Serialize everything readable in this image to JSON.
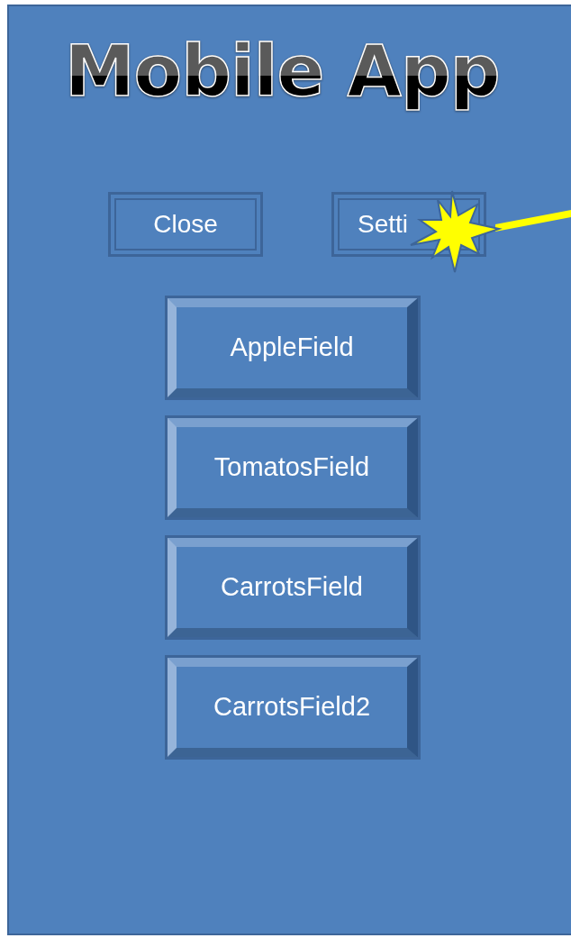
{
  "title": "Mobile App",
  "top_buttons": [
    {
      "label": "Close"
    },
    {
      "label": "Setti"
    }
  ],
  "field_buttons": [
    {
      "label": "AppleField"
    },
    {
      "label": "TomatosField"
    },
    {
      "label": "CarrotsField"
    },
    {
      "label": "CarrotsField2"
    }
  ]
}
